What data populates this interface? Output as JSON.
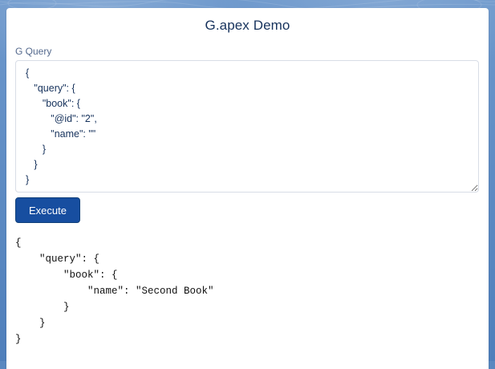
{
  "page": {
    "title": "G.apex Demo"
  },
  "query": {
    "label": "G Query",
    "value": "{\n   \"query\": {\n      \"book\": {\n         \"@id\": \"2\",\n         \"name\": \"\"\n      }\n   }\n}"
  },
  "actions": {
    "execute_label": "Execute"
  },
  "result": {
    "text": "{\n    \"query\": {\n        \"book\": {\n            \"name\": \"Second Book\"\n        }\n    }\n}"
  },
  "colors": {
    "button": "#174ea0",
    "title": "#16325c",
    "label": "#54698d",
    "background": "#5a88c0"
  }
}
